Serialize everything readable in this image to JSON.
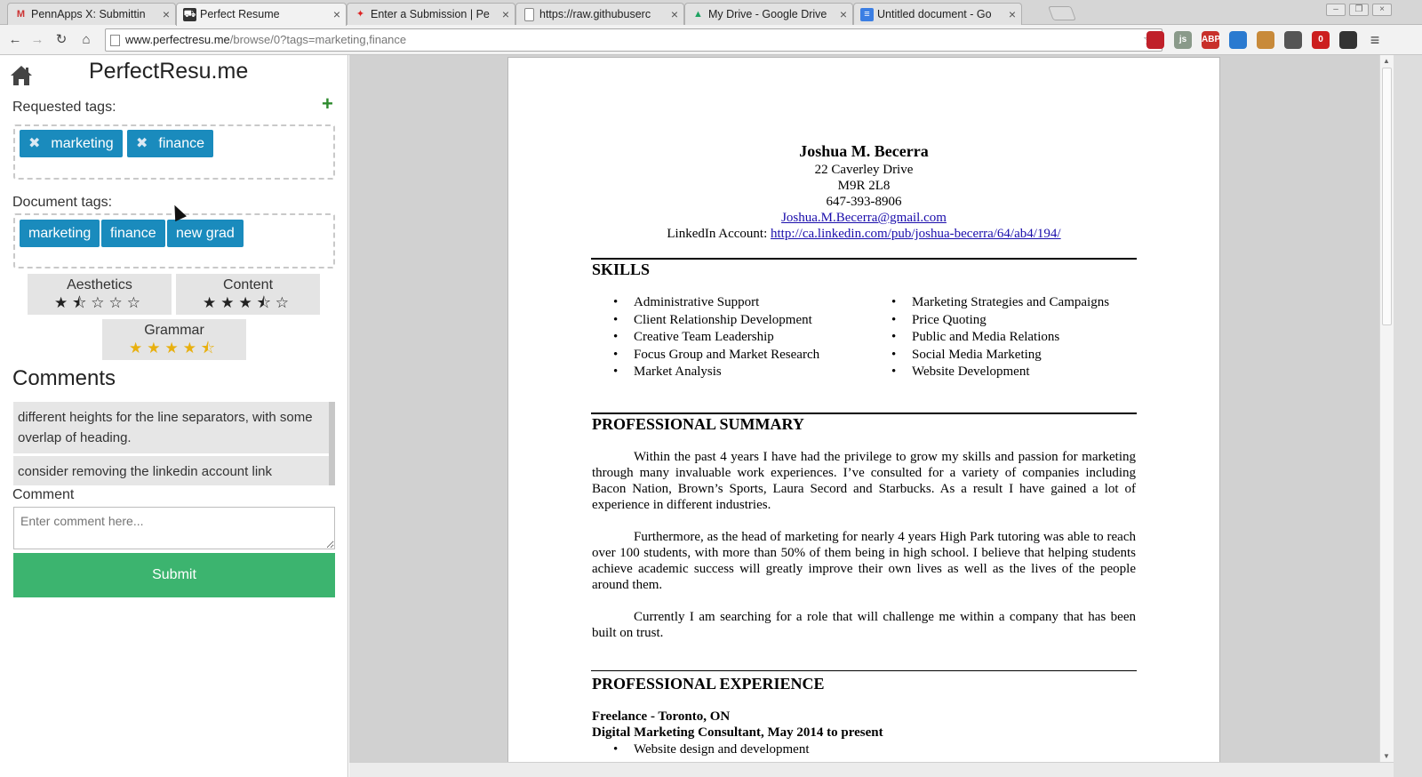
{
  "browser": {
    "tabs": [
      {
        "title": "PennApps X: Submittin",
        "favicon": "gmail-icon"
      },
      {
        "title": "Perfect Resume",
        "favicon": "car-icon",
        "active": true
      },
      {
        "title": "Enter a Submission | Pe",
        "favicon": "pin-icon"
      },
      {
        "title": "https://raw.githubuserc",
        "favicon": "page-icon"
      },
      {
        "title": "My Drive - Google Drive",
        "favicon": "drive-icon"
      },
      {
        "title": "Untitled document - Go",
        "favicon": "docs-icon"
      }
    ],
    "url_host": "www.perfectresu.me",
    "url_path": "/browse/0?tags=marketing,finance",
    "extensions": [
      {
        "name": "stop-extension-icon",
        "text": "",
        "color": "#c0202a"
      },
      {
        "name": "js-extension-icon",
        "text": "js",
        "color": "#8a9a8a"
      },
      {
        "name": "adblock-icon",
        "text": "ABP",
        "color": "#c8302a"
      },
      {
        "name": "shield-extension-icon",
        "text": "",
        "color": "#2a7ad0"
      },
      {
        "name": "cookie-extension-icon",
        "text": "",
        "color": "#c88a3a"
      },
      {
        "name": "eyedropper-extension-icon",
        "text": "",
        "color": "#555555"
      },
      {
        "name": "lastpass-extension-icon",
        "text": "0",
        "color": "#cc1f1f"
      },
      {
        "name": "sync-extension-icon",
        "text": "",
        "color": "#333333"
      }
    ]
  },
  "sidebar": {
    "site_title": "PerfectResu.me",
    "requested_tags_label": "Requested tags:",
    "requested_tags": [
      "marketing",
      "finance"
    ],
    "document_tags_label": "Document tags:",
    "document_tags": [
      "marketing",
      "finance",
      "new grad"
    ],
    "ratings": [
      {
        "label": "Aesthetics",
        "stars": "★⯪☆☆☆",
        "value": 1.5,
        "max": 5
      },
      {
        "label": "Content",
        "stars": "★★★⯪☆",
        "value": 3.5,
        "max": 5
      },
      {
        "label": "Grammar",
        "stars": "★★★★⯪",
        "value": 4.5,
        "max": 5
      }
    ],
    "comments_heading": "Comments",
    "comments": [
      "different heights for the line separators, with some overlap of heading.",
      "consider removing the linkedin account link"
    ],
    "comment_label": "Comment",
    "comment_placeholder": "Enter comment here...",
    "submit_label": "Submit",
    "colors": {
      "tag": "#1a8bbd",
      "submit": "#3cb46f",
      "add": "#2e8b2e",
      "grammar_stars": "#e8b00f"
    }
  },
  "resume": {
    "name": "Joshua M. Becerra",
    "address": "22 Caverley Drive",
    "postal": "M9R 2L8",
    "phone": "647-393-8906",
    "email": "Joshua.M.Becerra@gmail.com",
    "linkedin_label": "LinkedIn Account: ",
    "linkedin_url": "http://ca.linkedin.com/pub/joshua-becerra/64/ab4/194/",
    "skills_heading": "SKILLS",
    "skills_left": [
      "Administrative Support",
      "Client Relationship Development",
      "Creative Team Leadership",
      "Focus Group and Market Research",
      "Market Analysis"
    ],
    "skills_right": [
      "Marketing Strategies and Campaigns",
      "Price Quoting",
      "Public and Media Relations",
      "Social Media Marketing",
      "Website Development"
    ],
    "summary_heading": "PROFESSIONAL SUMMARY",
    "summary": [
      "Within the past 4 years I have had the privilege to grow my skills and passion for marketing through many invaluable work experiences. I’ve consulted for a variety of companies including Bacon Nation, Brown’s Sports, Laura Secord and Starbucks. As a result I have gained a lot of experience in different industries.",
      "Furthermore, as the head of marketing for nearly 4 years High Park tutoring was able to reach over 100 students, with more than 50% of them being in high school. I believe that helping students achieve academic success will greatly improve their own lives as well as the lives of the people around them.",
      "Currently I am searching for a role that will challenge me within a company that has been built on trust."
    ],
    "experience_heading": "PROFESSIONAL EXPERIENCE",
    "job_company": "Freelance - Toronto, ON",
    "job_title": "Digital Marketing Consultant, May 2014 to present",
    "job_bullet": "Website design and development"
  }
}
